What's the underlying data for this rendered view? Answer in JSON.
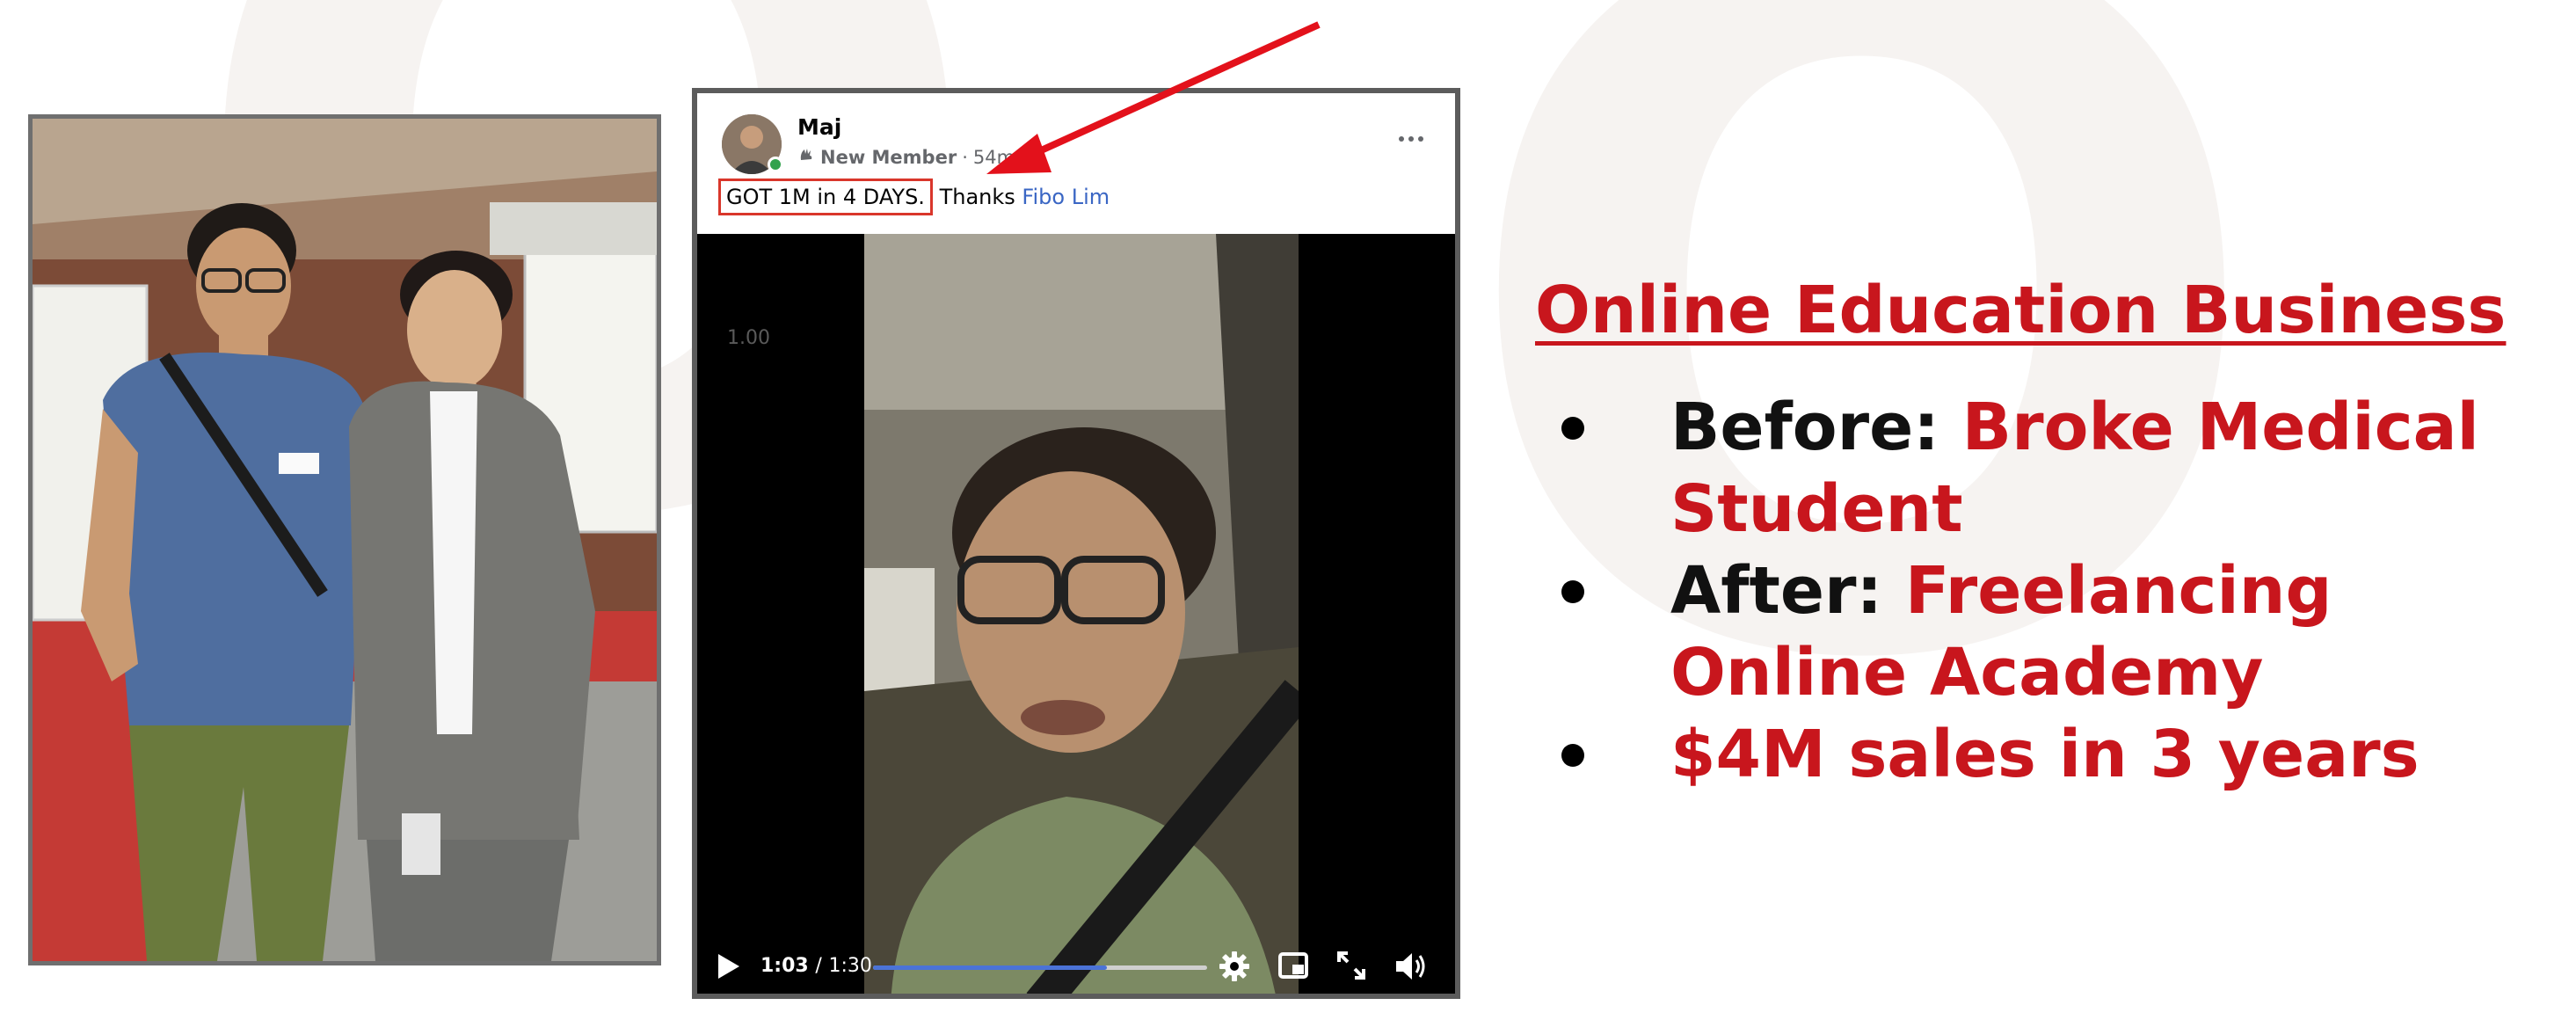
{
  "post": {
    "author": "Maj",
    "role": "New Member",
    "time": "54m",
    "highlight_text": "GOT 1M in 4 DAYS.",
    "thanks_text": "Thanks",
    "tagged_name": "Fibo Lim"
  },
  "video": {
    "speed_overlay": "1.00",
    "current_time": "1:03",
    "separator": "/",
    "duration": "1:30",
    "progress_fraction": 0.7
  },
  "panel": {
    "title": "Online Education Business",
    "items": [
      {
        "label": "Before:",
        "value": "Broke Medical Student"
      },
      {
        "label": "After:",
        "value": "Freelancing Online Academy"
      },
      {
        "label": "",
        "value": "$4M sales in 3 years"
      }
    ]
  },
  "colors": {
    "accent_red": "#c8161d",
    "link_blue": "#3a66c4",
    "progress_blue": "#4b73d7",
    "online_green": "#31a24c"
  }
}
